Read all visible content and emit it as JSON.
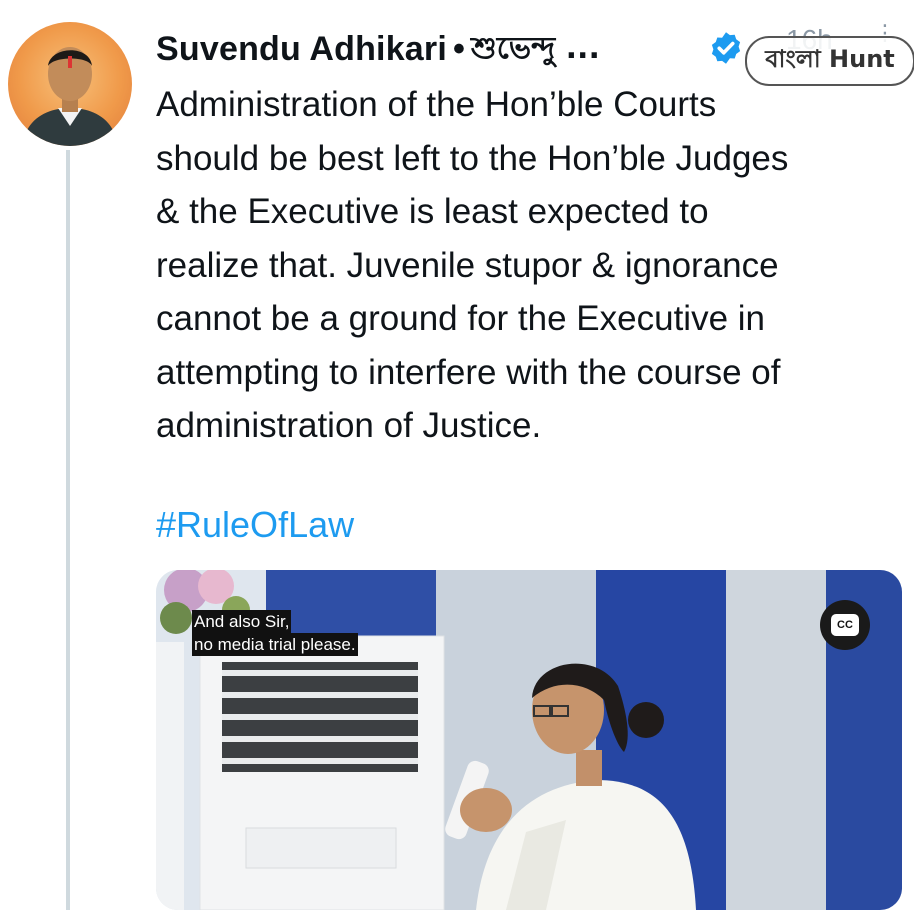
{
  "author": {
    "name": "Suvendu Adhikari",
    "separator": "•",
    "bengali_name": "শুভেন্দু ...",
    "verified_icon": "verified-badge-icon",
    "timestamp": "16h",
    "avatar_icon": "profile-avatar"
  },
  "watermark": {
    "text": "বাংলা Hunt"
  },
  "tweet": {
    "lines": [
      "Administration of the Hon’ble Courts",
      "should be best left to the Hon’ble Judges",
      "& the Executive is least expected to",
      "realize that. Juvenile stupor & ignorance",
      "cannot be a ground for the Executive in",
      "attempting to interfere with the course of",
      "administration of Justice."
    ],
    "hashtag": "#RuleOfLaw"
  },
  "media": {
    "caption_line1": "And also Sir,",
    "caption_line2": "no media trial please.",
    "cc_label": "CC"
  },
  "colors": {
    "accent": "#1d9bf0",
    "text": "#0f1419",
    "muted": "#8b98a5",
    "thread_line": "#cfd9de"
  }
}
